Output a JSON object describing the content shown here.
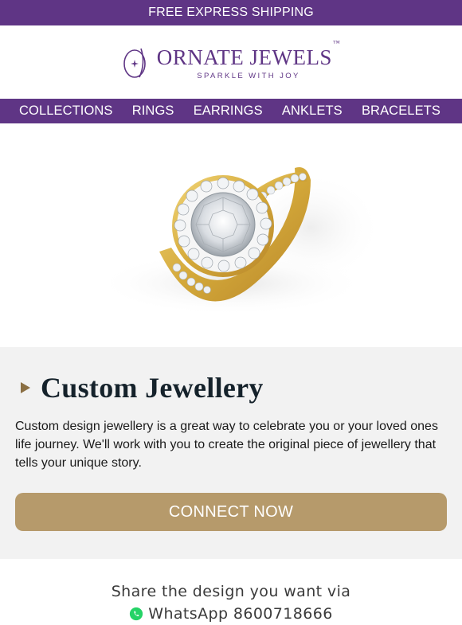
{
  "topbar": {
    "text": "FREE EXPRESS SHIPPING"
  },
  "header": {
    "brand": "ORNATE JEWELS",
    "trademark": "™",
    "tagline": "SPARKLE WITH JOY",
    "logo_icon": "jewel-oval-star-icon"
  },
  "nav": {
    "items": [
      {
        "label": "COLLECTIONS"
      },
      {
        "label": "RINGS"
      },
      {
        "label": "EARRINGS"
      },
      {
        "label": "ANKLETS"
      },
      {
        "label": "BRACELETS"
      }
    ]
  },
  "hero": {
    "image": "gold-halo-diamond-ring"
  },
  "custom": {
    "heading": "Custom Jewellery",
    "description": "Custom design jewellery is a great way to celebrate you or your loved ones life journey. We'll work with you to create the original piece of jewellery that tells your unique story.",
    "button_label": "CONNECT NOW"
  },
  "share": {
    "line1": "Share the design you want via",
    "line2": "WhatsApp 8600718666",
    "icon": "whatsapp-icon"
  },
  "colors": {
    "brand_purple": "#5f3585",
    "accent_gold": "#b69a6b",
    "section_bg": "#f2f2f2",
    "heading_dark": "#15222b"
  }
}
